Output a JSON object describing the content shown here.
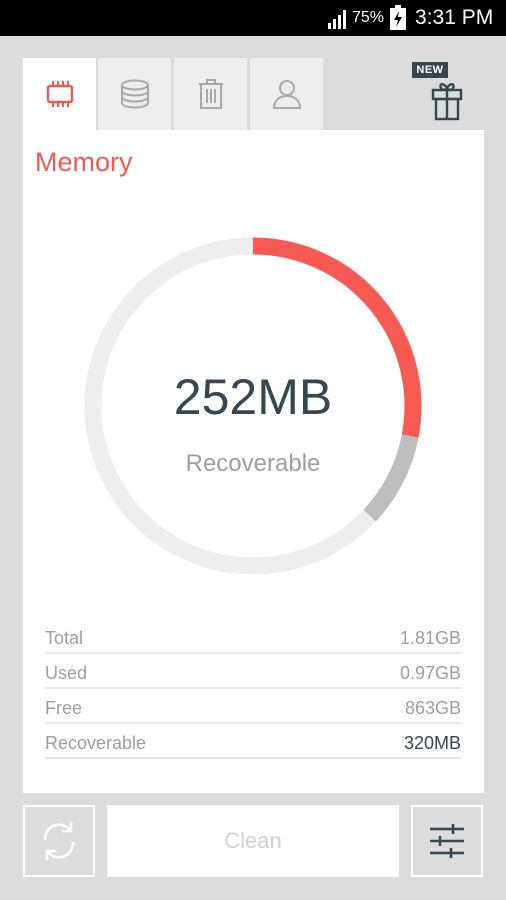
{
  "status_bar": {
    "battery_percent": "75%",
    "time": "3:31 PM",
    "icons": [
      "signal-icon",
      "battery-charging-icon"
    ]
  },
  "tabs": [
    {
      "name": "memory",
      "icon": "chip-icon",
      "active": true
    },
    {
      "name": "storage",
      "icon": "database-icon",
      "active": false
    },
    {
      "name": "trash",
      "icon": "trash-icon",
      "active": false
    },
    {
      "name": "user",
      "icon": "user-icon",
      "active": false
    }
  ],
  "gift": {
    "badge": "NEW",
    "icon": "gift-icon"
  },
  "card": {
    "title": "Memory",
    "gauge": {
      "value": "252MB",
      "label": "Recoverable",
      "recoverable_fraction": 0.28,
      "used_fraction": 0.09,
      "colors": {
        "recoverable": "#f75a52",
        "used": "#bdbdbd",
        "track": "#eeeeee"
      }
    },
    "stats": [
      {
        "label": "Total",
        "value": "1.81GB"
      },
      {
        "label": "Used",
        "value": "0.97GB"
      },
      {
        "label": "Free",
        "value": "863GB"
      },
      {
        "label": "Recoverable",
        "value": "320MB"
      }
    ]
  },
  "actions": {
    "refresh_icon": "refresh-icon",
    "clean_label": "Clean",
    "settings_icon": "sliders-icon"
  },
  "colors": {
    "accent": "#f1594f",
    "text_dark": "#37474f",
    "text_muted": "#9e9e9e",
    "background": "#dcdcdc"
  }
}
